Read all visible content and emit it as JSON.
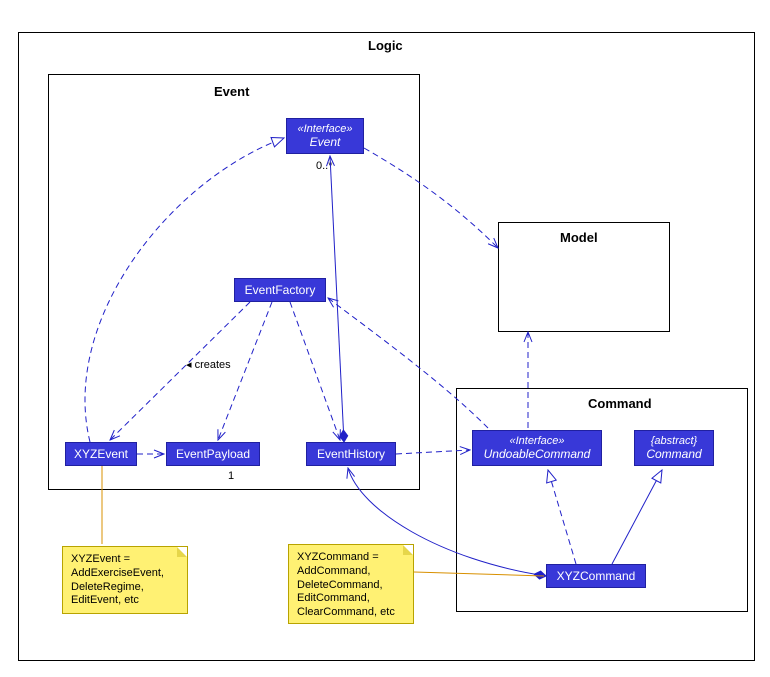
{
  "packages": {
    "logic": "Logic",
    "event": "Event",
    "model": "Model",
    "command": "Command"
  },
  "classes": {
    "eventIface": {
      "stereo": "«Interface»",
      "name": "Event"
    },
    "eventFactory": "EventFactory",
    "xyzEvent": "XYZEvent",
    "eventPayload": "EventPayload",
    "eventHistory": "EventHistory",
    "undoableCmd": {
      "stereo": "«Interface»",
      "name": "UndoableCommand"
    },
    "abstractCmd": {
      "stereo": "{abstract}",
      "name": "Command"
    },
    "xyzCommand": "XYZCommand"
  },
  "labels": {
    "creates": "◂ creates",
    "mult0star": "0..*",
    "mult1": "1"
  },
  "notes": {
    "xyzEventNote": "XYZEvent = AddExerciseEvent, DeleteRegime, EditEvent, etc",
    "xyzCommandNote": "XYZCommand = AddCommand, DeleteCommand, EditCommand, ClearCommand, etc"
  }
}
